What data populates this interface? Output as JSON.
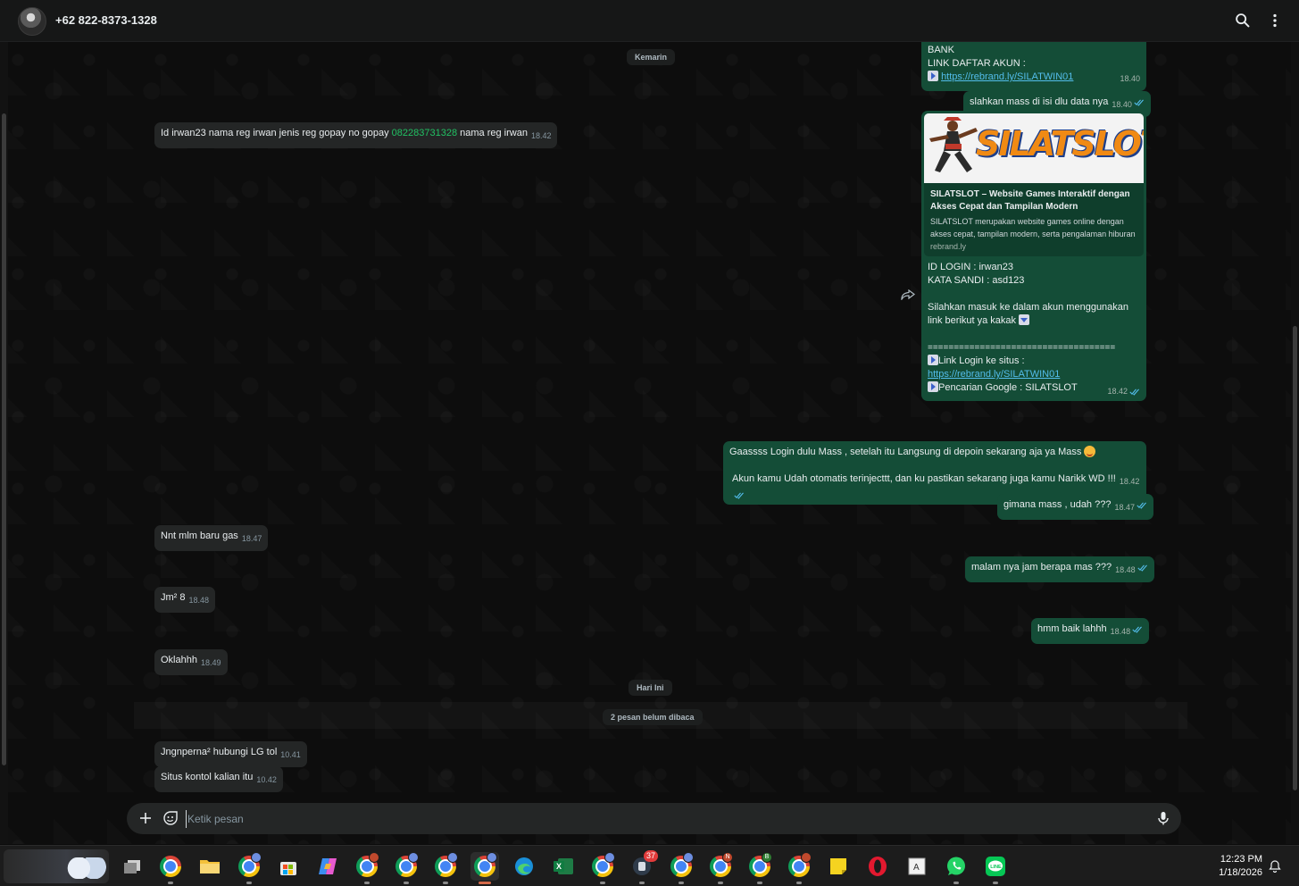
{
  "header": {
    "contact_name": "+62 822-8373-1328"
  },
  "chat": {
    "date_yesterday": "Kemarin",
    "date_today": "Hari Ini",
    "unread_label": "2 pesan belum dibaca",
    "messages": [
      {
        "dir": "out",
        "text_lines": [
          "BANK",
          "LINK DAFTAR AKUN :"
        ],
        "link": "https://rebrand.ly/SILATWIN01",
        "time": "18.40"
      },
      {
        "dir": "out",
        "text": "slahkan mass di isi dlu data nya",
        "time": "18.40"
      },
      {
        "dir": "in",
        "text_before": "Id irwan23 nama reg irwan jenis reg gopay no gopay ",
        "phone": "082283731328",
        "text_after": " nama reg irwan",
        "time": "18.42"
      },
      {
        "dir": "out",
        "text": "Gaassss Login dulu Mass  , setelah itu Langsung di depoin sekarang aja ya Mass",
        "text2": "Akun kamu Udah otomatis terinjecttt, dan ku pastikan sekarang juga kamu Narikk WD !!!",
        "time": "18.42"
      },
      {
        "dir": "out",
        "text": "gimana mass , udah ???",
        "time": "18.47"
      },
      {
        "dir": "in",
        "text": "Nnt mlm baru gas",
        "time": "18.47"
      },
      {
        "dir": "out",
        "text": "malam nya jam berapa mas ???",
        "time": "18.48"
      },
      {
        "dir": "in",
        "text": "Jm² 8",
        "time": "18.48"
      },
      {
        "dir": "out",
        "text": "hmm baik lahhh",
        "time": "18.48"
      },
      {
        "dir": "in",
        "text": "Oklahhh",
        "time": "18.49"
      },
      {
        "dir": "in",
        "text": "Jngnperna² hubungi LG tol",
        "time": "10.41"
      },
      {
        "dir": "in",
        "text": "Situs kontol kalian itu",
        "time": "10.42"
      }
    ],
    "card": {
      "banner_text": "SILATSLOT",
      "preview_title": "SILATSLOT – Website Games Interaktif dengan Akses Cepat dan Tampilan Modern",
      "preview_desc": "SILATSLOT merupakan website games online dengan akses cepat, tampilan modern, serta pengalaman hiburan",
      "preview_domain": "rebrand.ly",
      "login_line": "ID LOGIN : irwan23",
      "password_line": "KATA SANDI : asd123",
      "instruction": "Silahkan masuk ke dalam akun menggunakan link berikut ya kakak",
      "separator": "====================================",
      "login_link_label": "Link Login ke situs  :",
      "login_link": "https://rebrand.ly/SILATWIN01",
      "google_search": "Pencarian Google : SILATSLOT",
      "time": "18.42"
    }
  },
  "composer": {
    "placeholder": "Ketik pesan"
  },
  "taskbar": {
    "time": "12:23 PM",
    "date": "1/18/2026",
    "badge_count": "37",
    "chrome_badge_letters": [
      "N",
      "B"
    ]
  },
  "colors": {
    "outgoing_bubble": "#144d37",
    "incoming_bubble": "#242626",
    "link_blue": "#53bdeb",
    "phone_green": "#21c063",
    "read_tick": "#53bdeb"
  }
}
